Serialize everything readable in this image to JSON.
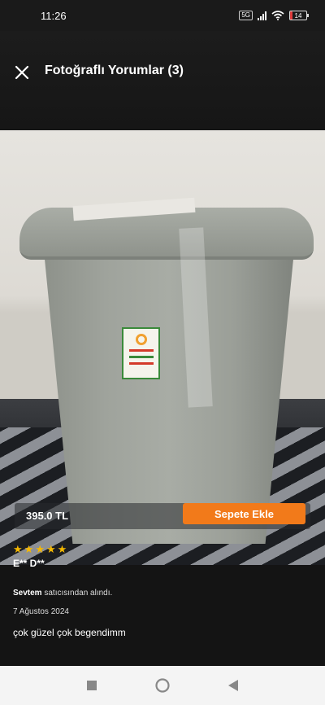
{
  "status_bar": {
    "time": "11:26",
    "sim_label": "5G",
    "battery_level": "14",
    "battery_fraction": 0.14,
    "icons": [
      "sim-icon",
      "signal-icon",
      "wifi-icon",
      "battery-icon"
    ]
  },
  "header": {
    "title": "Fotoğraflı Yorumlar (3)",
    "close_icon": "close-icon"
  },
  "product": {
    "price": "395.0 TL",
    "add_to_cart_label": "Sepete Ekle",
    "accent_color": "#f27a1a"
  },
  "review": {
    "rating": 5,
    "rating_max": 5,
    "reviewer": "E** D**",
    "seller_name": "Sevtem",
    "seller_suffix": " satıcısından alındı.",
    "date": "7 Ağustos 2024",
    "text": "çok güzel çok begendimm"
  },
  "nav_bar": {
    "icons": [
      "recent-apps-icon",
      "home-icon",
      "back-icon"
    ]
  }
}
